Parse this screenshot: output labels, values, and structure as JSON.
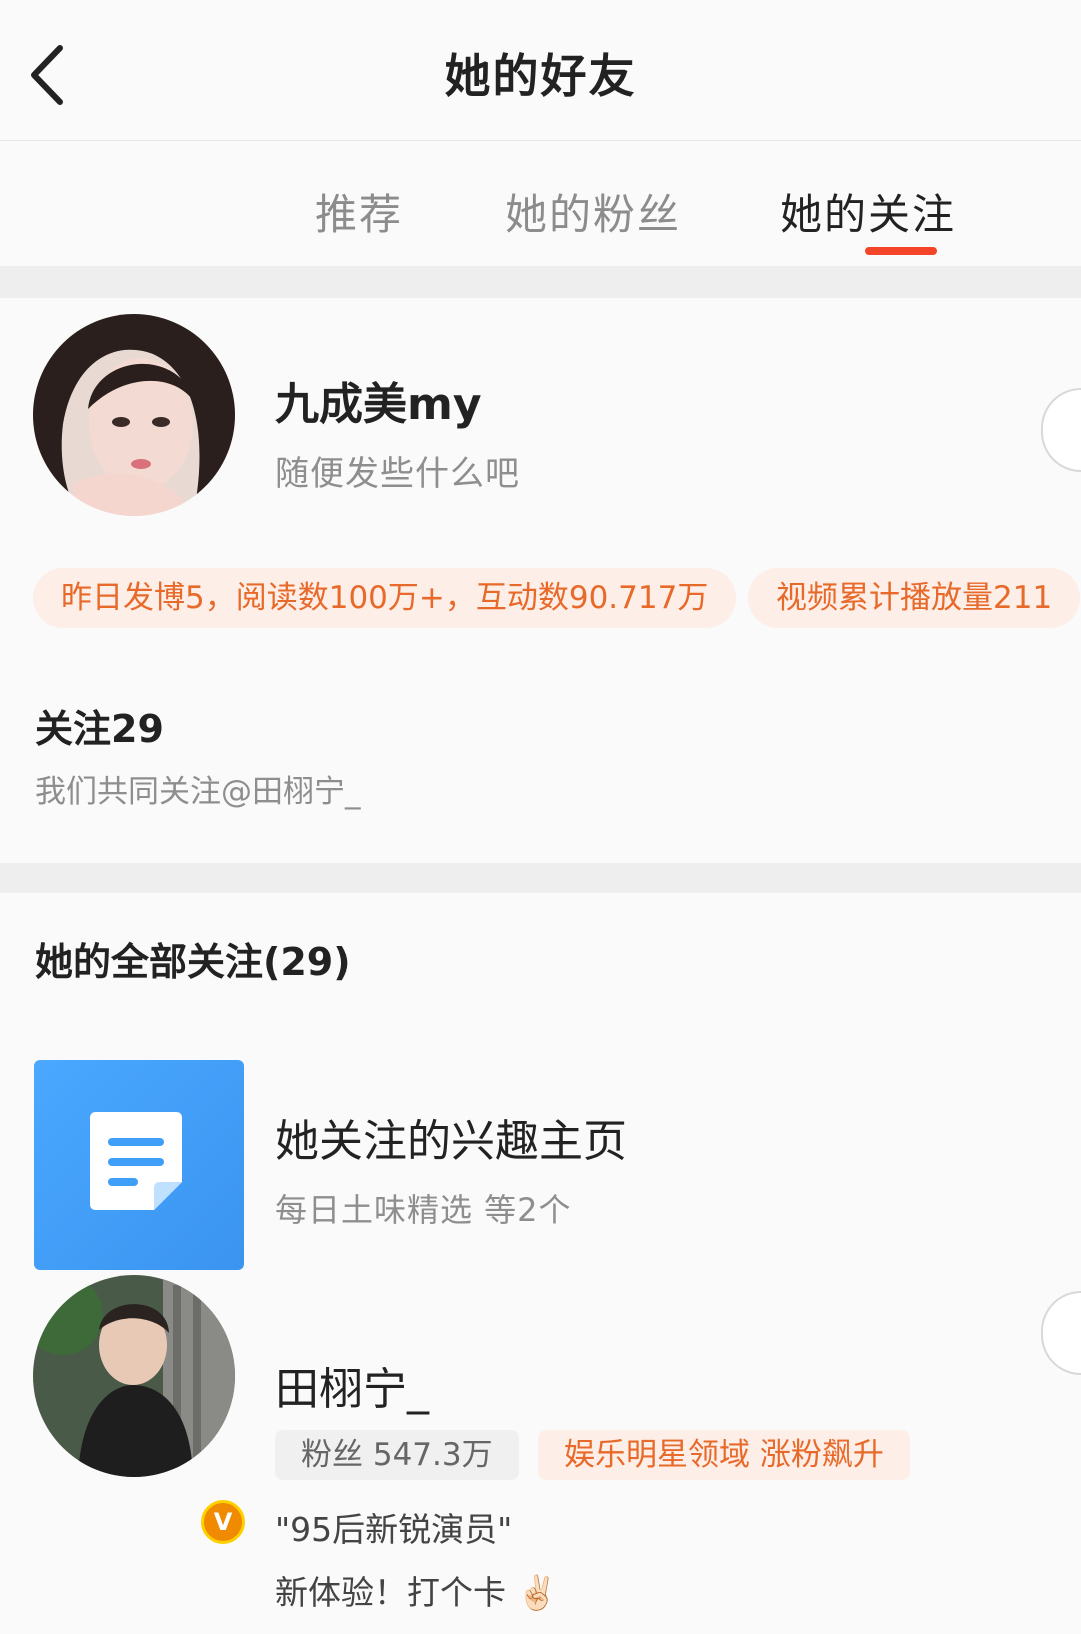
{
  "header": {
    "title": "她的好友"
  },
  "tabs": [
    {
      "label": "推荐"
    },
    {
      "label": "她的粉丝"
    },
    {
      "label": "她的关注"
    }
  ],
  "profile": {
    "name": "九成美my",
    "bio": "随便发些什么吧",
    "stats": [
      "昨日发博5，阅读数100万+，互动数90.717万",
      "视频累计播放量211"
    ],
    "follow_count": "关注29",
    "mutual": "我们共同关注@田栩宁_"
  },
  "list": {
    "title": "她的全部关注(29)",
    "interest": {
      "title": "她关注的兴趣主页",
      "subtitle": "每日土味精选 等2个"
    },
    "user": {
      "name": "田栩宁_",
      "fans": "粉丝 547.3万",
      "rank": "娱乐明星领域 涨粉飙升",
      "desc": "\"95后新锐演员\"",
      "post": "新体验！打个卡 ✌🏻",
      "badge": "V"
    }
  },
  "colors": {
    "accent": "#f4442a",
    "tag_text": "#e86a2a",
    "tag_bg": "#fdeee7",
    "tile_blue": "#3f9ef7"
  }
}
